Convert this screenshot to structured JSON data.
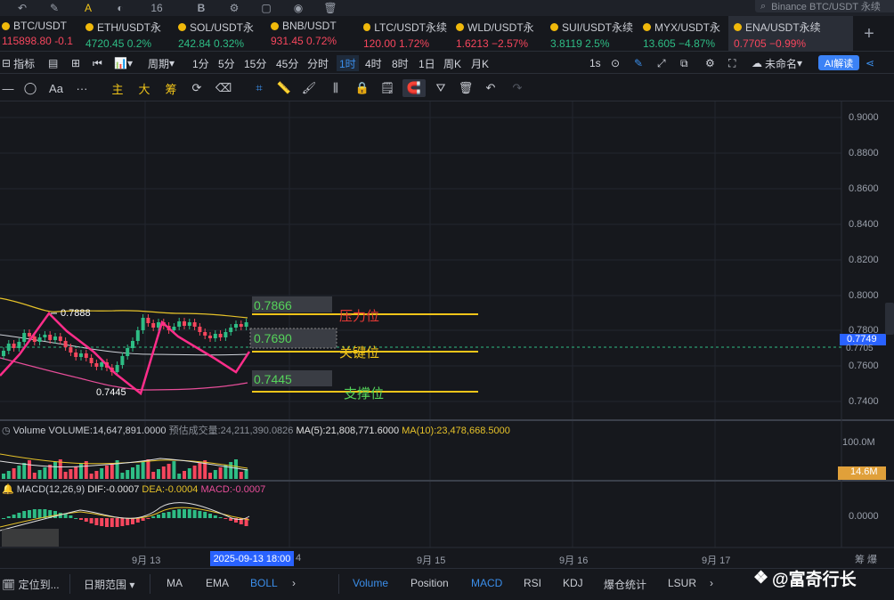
{
  "drawbar": {
    "font_size": "16",
    "bold": "B",
    "search": "Binance BTC/USDT 永续"
  },
  "tickers": [
    {
      "name": "BTC/USDT",
      "price": "115898.80",
      "change": "-0.1",
      "dir": "down"
    },
    {
      "name": "ETH/USDT永",
      "price": "4720.45",
      "change": "0.2%",
      "dir": "up"
    },
    {
      "name": "SOL/USDT永",
      "price": "242.84",
      "change": "0.32%",
      "dir": "up"
    },
    {
      "name": "BNB/USDT",
      "price": "931.45",
      "change": "0.72%",
      "dir": "down"
    },
    {
      "name": "LTC/USDT永续",
      "price": "120.00",
      "change": "1.72%",
      "dir": "down"
    },
    {
      "name": "WLD/USDT永",
      "price": "1.6213",
      "change": "−2.57%",
      "dir": "down"
    },
    {
      "name": "SUI/USDT永续",
      "price": "3.8119",
      "change": "2.5%",
      "dir": "up"
    },
    {
      "name": "MYX/USDT永",
      "price": "13.605",
      "change": "−4.87%",
      "dir": "up"
    },
    {
      "name": "ENA/USDT永续",
      "price": "0.7705",
      "change": "−0.99%",
      "dir": "down"
    }
  ],
  "interval": {
    "indicators": "指标",
    "period": "周期",
    "items": [
      "1分",
      "5分",
      "15分",
      "45分",
      "分时",
      "1时",
      "4时",
      "8时",
      "1日",
      "周K",
      "月K"
    ],
    "active": "1时",
    "seconds": "1s",
    "unnamed": "未命名",
    "ai": "AI解读"
  },
  "tools": {
    "text": "Aa",
    "more": "···",
    "main": "主",
    "big": "大",
    "chips": "筹"
  },
  "axis": {
    "prices": [
      "0.9000",
      "0.8800",
      "0.8600",
      "0.8400",
      "0.8200",
      "0.8000",
      "0.7800",
      "0.7600",
      "0.7400"
    ],
    "current_price": "0.7749",
    "current_price_sub": "0.7705",
    "volume_top": "100.0M",
    "volume_current": "14.6M",
    "macd_zero": "0.0000",
    "corner": "筹 爆"
  },
  "annotations": {
    "high": "0.7888",
    "low": "0.7445",
    "resistance_value": "0.7866",
    "resistance_label": "压力位",
    "key_value": "0.7690",
    "key_label": "关键位",
    "support_value": "0.7445",
    "support_label": "支撑位"
  },
  "volume_panel": {
    "title": "Volume",
    "volume": "VOLUME:14,647,891.0000",
    "forecast": "预估成交量:24,211,390.0826",
    "ma5": "MA(5):21,808,771.6000",
    "ma10": "MA(10):23,478,668.5000"
  },
  "macd_panel": {
    "title": "MACD(12,26,9)",
    "dif": "DIF:-0.0007",
    "dea": "DEA:-0.0004",
    "macd": "MACD:-0.0007"
  },
  "dates": {
    "d13": "9月 13",
    "cursor": "2025-09-13 18:00",
    "d14": "4",
    "d15": "9月 15",
    "d16": "9月 16",
    "d17": "9月 17"
  },
  "bottom": {
    "locate": "定位到...",
    "date_range": "日期范围",
    "main_inds": [
      "MA",
      "EMA",
      "BOLL"
    ],
    "sub_inds": [
      "Volume",
      "Position",
      "MACD",
      "RSI",
      "KDJ",
      "爆仓统计",
      "LSUR"
    ],
    "active_main": "BOLL",
    "active_sub": [
      "Volume",
      "MACD"
    ],
    "watermark": "@富奇行长"
  },
  "colors": {
    "up": "#2ebd85",
    "down": "#f6465d",
    "accent": "#3b8eea",
    "level_line": "#f0c419",
    "pattern": "#ff2d8a"
  }
}
